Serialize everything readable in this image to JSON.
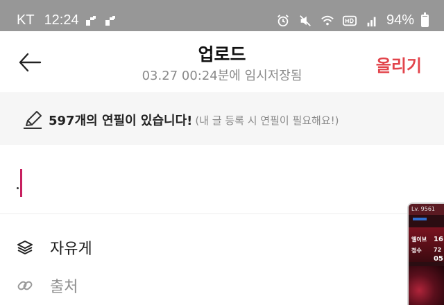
{
  "status_bar": {
    "carrier": "KT",
    "time": "12:24",
    "battery": "94%"
  },
  "header": {
    "title": "업로드",
    "subtitle": "03.27 00:24분에 임시저장됨",
    "upload_label": "올리기"
  },
  "banner": {
    "main": "597개의 연필이 있습니다!",
    "note": "(내 글 등록 시 연필이 필요해요!)"
  },
  "options": {
    "board": "자유게",
    "source": "출처"
  },
  "overlay": {
    "level": "Lv. 9561",
    "line1": "엘이브",
    "line2": "정수",
    "val1": "16",
    "val2": "72",
    "val3": "05"
  },
  "colors": {
    "accent": "#e2444b",
    "caret": "#c7205f",
    "statusbar": "#979797"
  }
}
